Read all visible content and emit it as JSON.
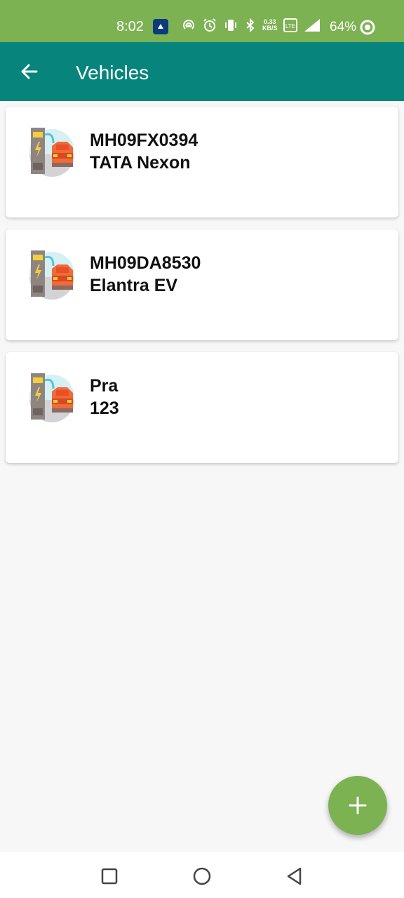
{
  "status_bar": {
    "time": "8:02",
    "net_speed_value": "0.33",
    "net_speed_unit": "KB/S",
    "battery": "64%"
  },
  "app_bar": {
    "title": "Vehicles",
    "back_icon": "arrow-left-icon"
  },
  "vehicles": [
    {
      "plate": "MH09FX0394",
      "model": "TATA Nexon",
      "icon": "ev-charger-car-icon"
    },
    {
      "plate": "MH09DA8530",
      "model": "Elantra EV",
      "icon": "ev-charger-car-icon"
    },
    {
      "plate": "Pra",
      "model": "123",
      "icon": "ev-charger-car-icon"
    }
  ],
  "fab": {
    "icon": "plus-icon",
    "accent": "#7cb251"
  },
  "colors": {
    "status_bar": "#7cb251",
    "app_bar": "#07857c",
    "background": "#f7f7f7"
  },
  "nav": {
    "recent": "square-icon",
    "home": "circle-icon",
    "back": "triangle-back-icon"
  }
}
